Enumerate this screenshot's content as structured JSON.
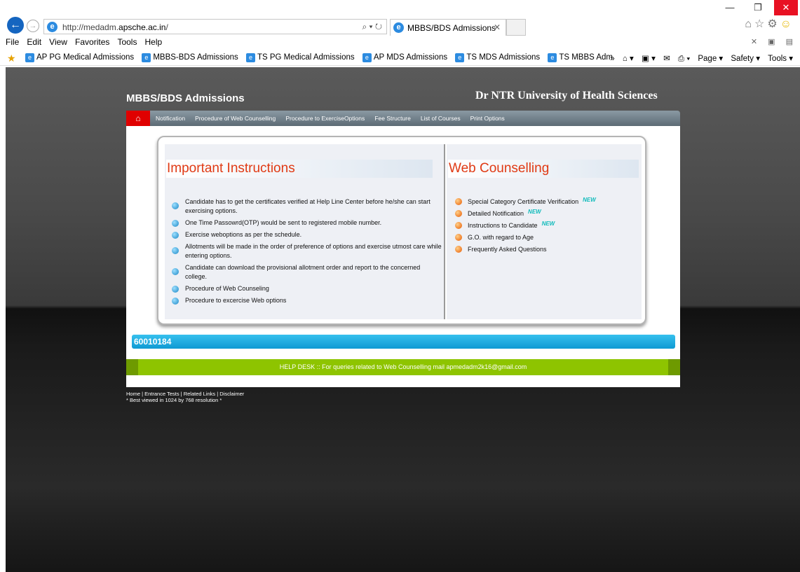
{
  "browser": {
    "url_prefix": "http://medadm.",
    "url_domain": "apsche.ac.in",
    "url_suffix": "/",
    "tab_title": "MBBS/BDS Admissions",
    "menu": [
      "File",
      "Edit",
      "View",
      "Favorites",
      "Tools",
      "Help"
    ],
    "favorites": [
      "AP PG Medical Admissions",
      "MBBS-BDS Admissions",
      "TS PG Medical Admissions",
      "AP MDS Admissions",
      "TS MDS Admissions",
      "TS MBBS Adm"
    ],
    "toolbar": [
      "Page ▾",
      "Safety ▾",
      "Tools ▾"
    ]
  },
  "site": {
    "title": "MBBS/BDS Admissions",
    "university": "Dr NTR University of Health Sciences",
    "nav": [
      "Notification",
      "Procedure of Web Counselling",
      "Procedure to ExerciseOptions",
      "Fee Structure",
      "List of Courses",
      "Print Options"
    ]
  },
  "instructions": {
    "heading": "Important Instructions",
    "items": [
      "Candidate has to get the certificates verified at Help Line Center before he/she can start exercising options.",
      "One Time Passowrd(OTP) would be sent to registered mobile number.",
      "Exercise weboptions as per the schedule.",
      "Allotments will be made in the order of preference of options and exercise utmost care while entering options.",
      "Candidate can download the provisional allotment order and report to the concerned college.",
      "Procedure of Web Counseling",
      "Procedure to excercise Web options"
    ]
  },
  "counselling": {
    "heading": "Web Counselling",
    "new_label": "NEW",
    "items": [
      "Special Category Certificate Verification",
      "Detailed Notification",
      "Instructions to Candidate",
      "G.O. with regard to Age",
      "Frequently Asked Questions"
    ]
  },
  "ticker": "60010184",
  "helpdesk": "HELP DESK :: For queries related to Web Counselling mail apmedadm2k16@gmail.com",
  "footer": {
    "links": "Home | Entrance Tests | Related Links | Disclaimer",
    "note": "* Best viewed in 1024 by 768 resolution *"
  }
}
